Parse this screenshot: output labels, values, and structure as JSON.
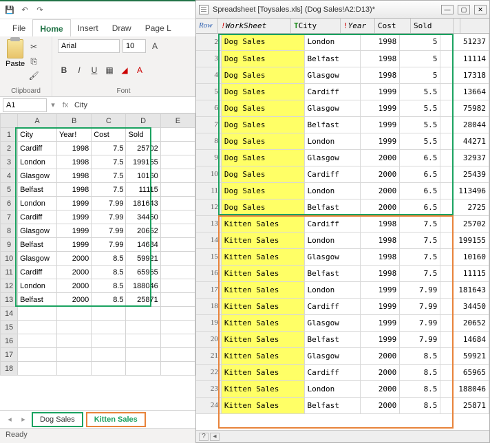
{
  "excel": {
    "tabs": {
      "file": "File",
      "home": "Home",
      "insert": "Insert",
      "draw": "Draw",
      "page": "Page L"
    },
    "ribbon": {
      "paste": "Paste",
      "clipboard_label": "Clipboard",
      "font_label": "Font",
      "font_name": "Arial",
      "font_size": "10"
    },
    "namebox": "A1",
    "formula": "City",
    "columns": [
      "A",
      "B",
      "C",
      "D",
      "E"
    ],
    "headers": [
      "City",
      "Year!",
      "Cost",
      "Sold"
    ],
    "rows": [
      [
        "Cardiff",
        "1998",
        "7.5",
        "25702"
      ],
      [
        "London",
        "1998",
        "7.5",
        "199155"
      ],
      [
        "Glasgow",
        "1998",
        "7.5",
        "10160"
      ],
      [
        "Belfast",
        "1998",
        "7.5",
        "11115"
      ],
      [
        "London",
        "1999",
        "7.99",
        "181643"
      ],
      [
        "Cardiff",
        "1999",
        "7.99",
        "34450"
      ],
      [
        "Glasgow",
        "1999",
        "7.99",
        "20652"
      ],
      [
        "Belfast",
        "1999",
        "7.99",
        "14684"
      ],
      [
        "Glasgow",
        "2000",
        "8.5",
        "59921"
      ],
      [
        "Cardiff",
        "2000",
        "8.5",
        "65965"
      ],
      [
        "London",
        "2000",
        "8.5",
        "188046"
      ],
      [
        "Belfast",
        "2000",
        "8.5",
        "25871"
      ]
    ],
    "row_numbers": [
      "1",
      "2",
      "3",
      "4",
      "5",
      "6",
      "7",
      "8",
      "9",
      "10",
      "11",
      "12",
      "13",
      "14",
      "15",
      "16",
      "17",
      "18"
    ],
    "sheet_tabs": {
      "dog": "Dog Sales",
      "kitten": "Kitten Sales"
    },
    "status": "Ready"
  },
  "viewer": {
    "title": "Spreadsheet [Toysales.xls] (Dog Sales!A2:D13)*",
    "head": {
      "row": "Row",
      "ws_prefix": "!",
      "ws": "WorkSheet",
      "city_prefix": "T",
      "city": "City",
      "year_prefix": "!",
      "year": "Year",
      "cost": "Cost",
      "sold": "Sold"
    },
    "rows": [
      {
        "n": "2",
        "ws": "Dog Sales",
        "city": "London",
        "year": "1998",
        "cost": "5",
        "sold": "51237"
      },
      {
        "n": "3",
        "ws": "Dog Sales",
        "city": "Belfast",
        "year": "1998",
        "cost": "5",
        "sold": "11114"
      },
      {
        "n": "4",
        "ws": "Dog Sales",
        "city": "Glasgow",
        "year": "1998",
        "cost": "5",
        "sold": "17318"
      },
      {
        "n": "5",
        "ws": "Dog Sales",
        "city": "Cardiff",
        "year": "1999",
        "cost": "5.5",
        "sold": "13664"
      },
      {
        "n": "6",
        "ws": "Dog Sales",
        "city": "Glasgow",
        "year": "1999",
        "cost": "5.5",
        "sold": "75982"
      },
      {
        "n": "7",
        "ws": "Dog Sales",
        "city": "Belfast",
        "year": "1999",
        "cost": "5.5",
        "sold": "28044"
      },
      {
        "n": "8",
        "ws": "Dog Sales",
        "city": "London",
        "year": "1999",
        "cost": "5.5",
        "sold": "44271"
      },
      {
        "n": "9",
        "ws": "Dog Sales",
        "city": "Glasgow",
        "year": "2000",
        "cost": "6.5",
        "sold": "32937"
      },
      {
        "n": "10",
        "ws": "Dog Sales",
        "city": "Cardiff",
        "year": "2000",
        "cost": "6.5",
        "sold": "25439"
      },
      {
        "n": "11",
        "ws": "Dog Sales",
        "city": "London",
        "year": "2000",
        "cost": "6.5",
        "sold": "113496"
      },
      {
        "n": "12",
        "ws": "Dog Sales",
        "city": "Belfast",
        "year": "2000",
        "cost": "6.5",
        "sold": "2725"
      },
      {
        "n": "13",
        "ws": "Kitten Sales",
        "city": "Cardiff",
        "year": "1998",
        "cost": "7.5",
        "sold": "25702"
      },
      {
        "n": "14",
        "ws": "Kitten Sales",
        "city": "London",
        "year": "1998",
        "cost": "7.5",
        "sold": "199155"
      },
      {
        "n": "15",
        "ws": "Kitten Sales",
        "city": "Glasgow",
        "year": "1998",
        "cost": "7.5",
        "sold": "10160"
      },
      {
        "n": "16",
        "ws": "Kitten Sales",
        "city": "Belfast",
        "year": "1998",
        "cost": "7.5",
        "sold": "11115"
      },
      {
        "n": "17",
        "ws": "Kitten Sales",
        "city": "London",
        "year": "1999",
        "cost": "7.99",
        "sold": "181643"
      },
      {
        "n": "18",
        "ws": "Kitten Sales",
        "city": "Cardiff",
        "year": "1999",
        "cost": "7.99",
        "sold": "34450"
      },
      {
        "n": "19",
        "ws": "Kitten Sales",
        "city": "Glasgow",
        "year": "1999",
        "cost": "7.99",
        "sold": "20652"
      },
      {
        "n": "20",
        "ws": "Kitten Sales",
        "city": "Belfast",
        "year": "1999",
        "cost": "7.99",
        "sold": "14684"
      },
      {
        "n": "21",
        "ws": "Kitten Sales",
        "city": "Glasgow",
        "year": "2000",
        "cost": "8.5",
        "sold": "59921"
      },
      {
        "n": "22",
        "ws": "Kitten Sales",
        "city": "Cardiff",
        "year": "2000",
        "cost": "8.5",
        "sold": "65965"
      },
      {
        "n": "23",
        "ws": "Kitten Sales",
        "city": "London",
        "year": "2000",
        "cost": "8.5",
        "sold": "188046"
      },
      {
        "n": "24",
        "ws": "Kitten Sales",
        "city": "Belfast",
        "year": "2000",
        "cost": "8.5",
        "sold": "25871"
      }
    ],
    "footer": "?"
  }
}
